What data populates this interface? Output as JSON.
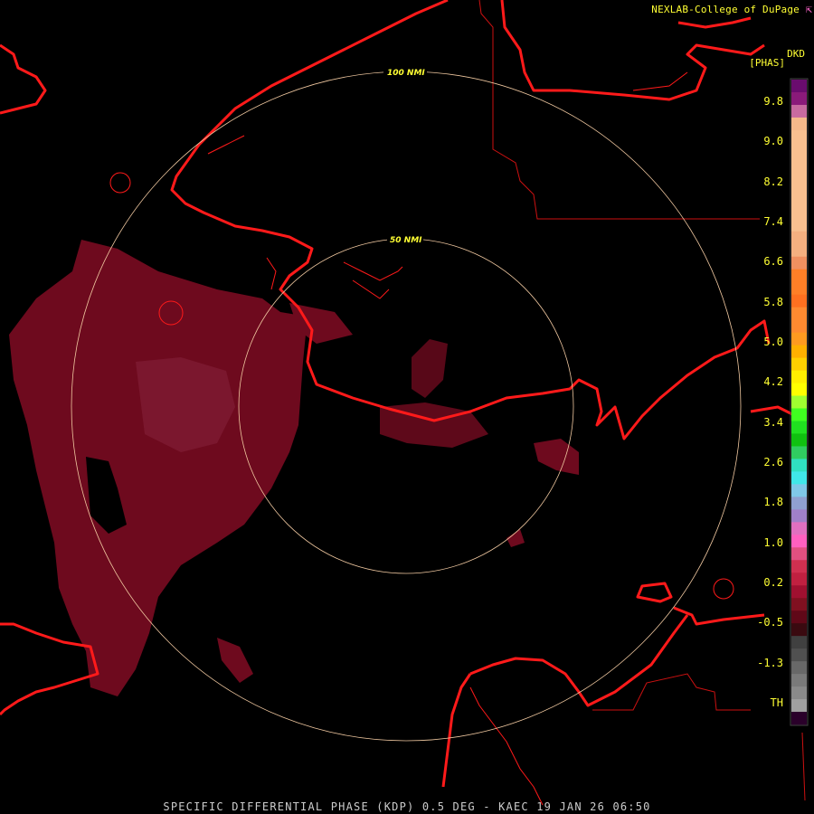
{
  "header": {
    "credit": "NEXLAB-College of DuPage",
    "credit_icon": "corner-arrow-icon",
    "product_code": "DKD",
    "unit": "[PHAS]"
  },
  "rings": [
    {
      "label": "50 NMI"
    },
    {
      "label": "100 NMI"
    }
  ],
  "scale": {
    "labels": [
      "9.8",
      "9.0",
      "8.2",
      "7.4",
      "6.6",
      "5.8",
      "5.0",
      "4.2",
      "3.4",
      "2.6",
      "1.8",
      "1.0",
      "0.2",
      "-0.5",
      "-1.3",
      "TH"
    ],
    "colors": [
      "#6a0c6e",
      "#8a1a7a",
      "#c86aa0",
      "#f5b88a",
      "#f8c090",
      "#f8c090",
      "#f8c090",
      "#f8c090",
      "#f8c090",
      "#f8c090",
      "#f8c090",
      "#f8c090",
      "#f5b080",
      "#f5b080",
      "#f09060",
      "#ff7f27",
      "#ff7f27",
      "#ff7020",
      "#ff8a30",
      "#ff8a30",
      "#ff9a20",
      "#ffb000",
      "#ffd000",
      "#ffee00",
      "#ffff00",
      "#a0ff30",
      "#40ff20",
      "#20e020",
      "#10c010",
      "#30cc60",
      "#30e0c0",
      "#40e8e8",
      "#80c8e8",
      "#90a0d0",
      "#a080c8",
      "#e070c0",
      "#ff60c0",
      "#e05080",
      "#d03050",
      "#c02040",
      "#a01030",
      "#801020",
      "#600818",
      "#3a0a10",
      "#404040",
      "#505050",
      "#686868",
      "#7a7a7a",
      "#8a8a8a",
      "#a0a0a0",
      "#2a002a"
    ]
  },
  "colors": {
    "background": "#000000",
    "coastline": "#ff1a1a",
    "county_line": "#cc1111",
    "range_ring": "#f0c8a0",
    "echo_main": "#6e0a1e",
    "echo_light": "#7e1a32"
  },
  "footer": {
    "caption": "SPECIFIC DIFFERENTIAL PHASE (KDP) 0.5 DEG - KAEC 19 JAN 26 06:50"
  }
}
